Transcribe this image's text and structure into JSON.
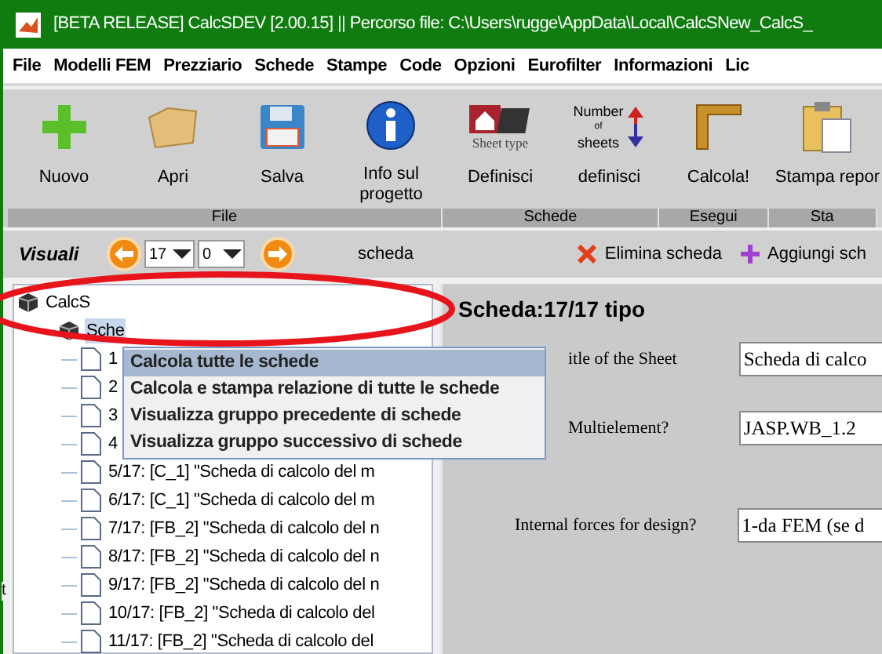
{
  "window": {
    "title": "[BETA RELEASE] CalcSDEV [2.00.15] || Percorso file: C:\\Users\\rugge\\AppData\\Local\\CalcSNew_CalcS_"
  },
  "menu_bar": [
    "File",
    "Modelli FEM",
    "Prezziario",
    "Schede",
    "Stampe",
    "Code",
    "Opzioni",
    "Eurofilter",
    "Informazioni",
    "Lic"
  ],
  "toolbar": {
    "buttons": [
      {
        "kind": "plus",
        "label": "Nuovo"
      },
      {
        "kind": "folder",
        "label": "Apri"
      },
      {
        "kind": "floppy",
        "label": "Salva"
      },
      {
        "kind": "info",
        "label": "Info sul progetto"
      },
      {
        "kind": "sheet_type",
        "label": "Definisci",
        "icon_text": "Sheet type"
      },
      {
        "kind": "number_sheets",
        "label": "definisci",
        "icon_text": [
          "Number",
          "of",
          "sheets"
        ]
      },
      {
        "kind": "ruler",
        "label": "Calcola!"
      },
      {
        "kind": "clipboard",
        "label": "Stampa repor"
      }
    ],
    "groups": [
      "File",
      "Schede",
      "Esegui",
      "Sta"
    ]
  },
  "sheet_bar": {
    "label": "Visuali",
    "sheet_number": "17",
    "sub_number": "0",
    "caption": "scheda",
    "actions": [
      {
        "kind": "delete",
        "label": "Elimina scheda"
      },
      {
        "kind": "add",
        "label": "Aggiungi sch"
      }
    ]
  },
  "tree": [
    {
      "label": "CalcS",
      "selected": false,
      "children": [
        {
          "label": "Sche",
          "selected": true,
          "children": [
            {
              "label": "1",
              "selected": false
            },
            {
              "label": "2",
              "selected": false
            },
            {
              "label": "3",
              "selected": false
            },
            {
              "label": "4",
              "selected": false
            },
            {
              "label": "5/17: [C_1] \"Scheda di calcolo del m",
              "selected": false
            },
            {
              "label": "6/17: [C_1] \"Scheda di calcolo del m",
              "selected": false
            },
            {
              "label": "7/17: [FB_2] \"Scheda di calcolo del n",
              "selected": false
            },
            {
              "label": "8/17: [FB_2] \"Scheda di calcolo del n",
              "selected": false
            },
            {
              "label": "9/17: [FB_2] \"Scheda di calcolo del n",
              "selected": false
            },
            {
              "label": "10/17: [FB_2] \"Scheda di calcolo del",
              "selected": false
            },
            {
              "label": "11/17: [FB_2] \"Scheda di calcolo del",
              "selected": false
            }
          ]
        }
      ]
    }
  ],
  "left_edge_text": "t",
  "context_menu": [
    {
      "label": "Calcola tutte le schede",
      "selected": true
    },
    {
      "label": "Calcola e stampa relazione di tutte le schede",
      "selected": false
    },
    {
      "label": "Visualizza gruppo precedente di schede",
      "selected": false
    },
    {
      "label": "Visualizza gruppo successivo di schede",
      "selected": false
    }
  ],
  "sheet_panel": {
    "heading": "Scheda:17/17 tipo",
    "fields": [
      {
        "label": "itle of the Sheet",
        "value": "Scheda di calco"
      },
      {
        "label": "Multielement?",
        "value": "JASP.WB_1.2"
      },
      {
        "label": "Internal forces for design?",
        "value": "1-da FEM (se d"
      }
    ]
  }
}
